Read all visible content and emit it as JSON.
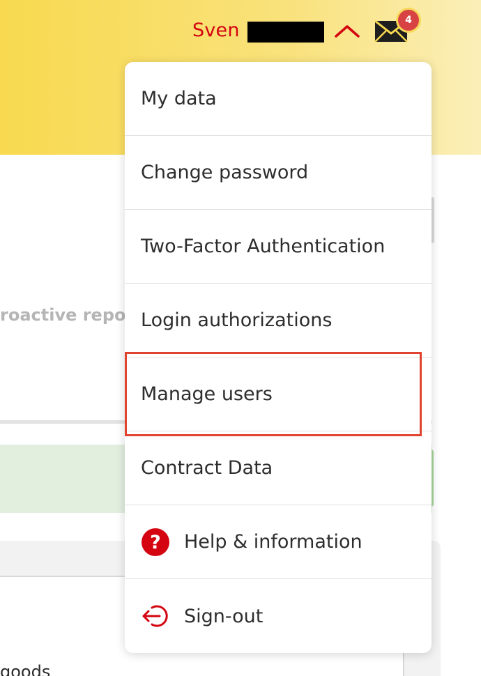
{
  "header": {
    "user_name": "Sven E",
    "notifications_count": "4"
  },
  "background": {
    "partial_text": "roactive report",
    "partial_text_bottom": "goods"
  },
  "menu": {
    "items": [
      {
        "label": "My data"
      },
      {
        "label": "Change password"
      },
      {
        "label": "Two-Factor Authentication"
      },
      {
        "label": "Login authorizations"
      },
      {
        "label": "Manage users"
      },
      {
        "label": "Contract Data"
      },
      {
        "label": "Help & information",
        "icon": "help-icon"
      },
      {
        "label": "Sign-out",
        "icon": "sign-out-icon"
      }
    ],
    "highlighted_item": "Manage users"
  },
  "colors": {
    "brand_red": "#d40511",
    "header_yellow": "#f8d94f",
    "highlight_border": "#e0432f",
    "badge_red": "#d94243"
  }
}
